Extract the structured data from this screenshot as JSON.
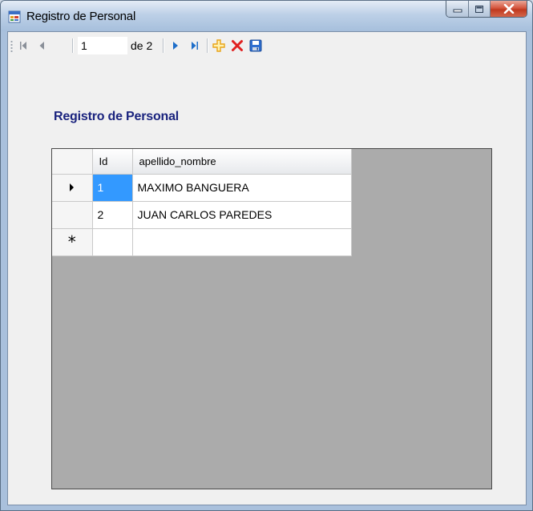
{
  "window": {
    "title": "Registro de Personal",
    "controls": [
      "minimize",
      "maximize",
      "close"
    ]
  },
  "navigator": {
    "position_value": "1",
    "count_label": "de 2",
    "buttons": {
      "move_first": "move-first-icon",
      "move_previous": "move-previous-icon",
      "move_next": "move-next-icon",
      "move_last": "move-last-icon",
      "add_new": "add-icon",
      "delete": "delete-icon",
      "save": "save-icon"
    }
  },
  "form": {
    "heading": "Registro de Personal"
  },
  "grid": {
    "columns": [
      "Id",
      "apellido_nombre"
    ],
    "rows": [
      {
        "id": "1",
        "apellido_nombre": "MAXIMO BANGUERA",
        "current": true
      },
      {
        "id": "2",
        "apellido_nombre": "JUAN CARLOS PAREDES",
        "current": false
      }
    ],
    "new_row_marker": "*"
  },
  "colors": {
    "heading": "#1a237e",
    "selection": "#3399ff",
    "grid_background": "#ababab",
    "nav_arrow": "#1e6ec9",
    "add_icon": "#e8a317",
    "delete_icon": "#e02020",
    "save_icon": "#2f6fd0"
  }
}
